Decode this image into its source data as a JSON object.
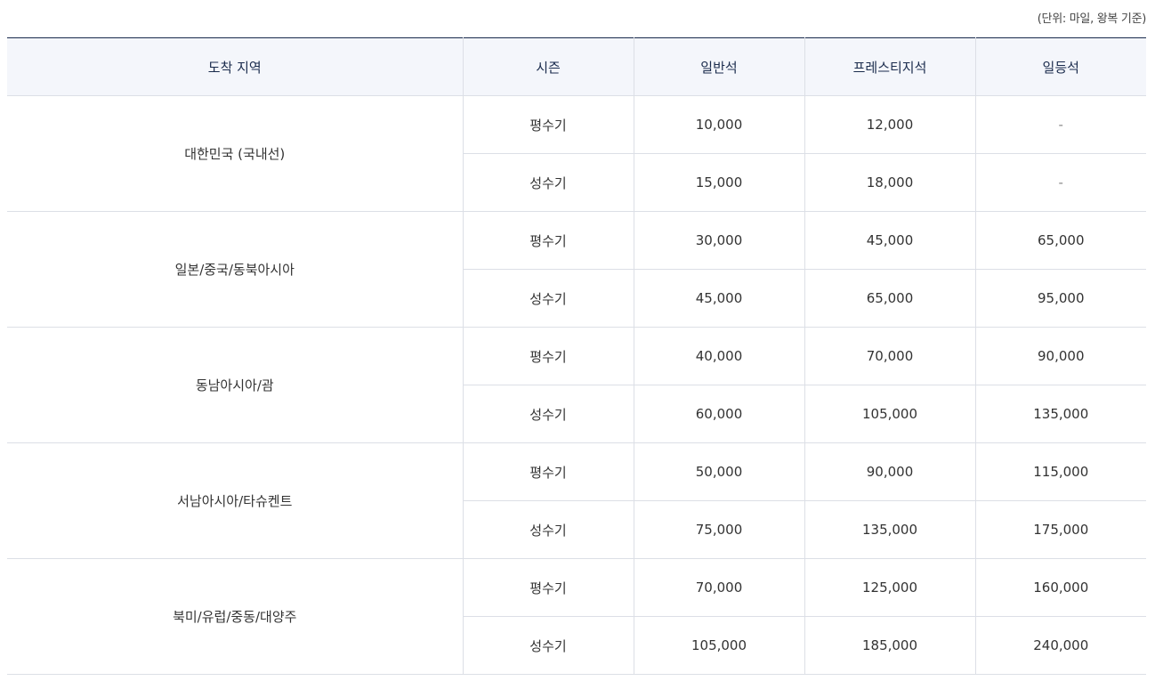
{
  "unit_note": "(단위: 마일, 왕복 기준)",
  "headers": {
    "region": "도착 지역",
    "season": "시즌",
    "standard": "일반석",
    "prestige": "프레스티지석",
    "first": "일등석"
  },
  "groups": [
    {
      "region": "대한민국 (국내선)",
      "rows": [
        {
          "season": "평수기",
          "standard": "10,000",
          "prestige": "12,000",
          "first": "-"
        },
        {
          "season": "성수기",
          "standard": "15,000",
          "prestige": "18,000",
          "first": "-"
        }
      ]
    },
    {
      "region": "일본/중국/동북아시아",
      "rows": [
        {
          "season": "평수기",
          "standard": "30,000",
          "prestige": "45,000",
          "first": "65,000"
        },
        {
          "season": "성수기",
          "standard": "45,000",
          "prestige": "65,000",
          "first": "95,000"
        }
      ]
    },
    {
      "region": "동남아시아/괌",
      "rows": [
        {
          "season": "평수기",
          "standard": "40,000",
          "prestige": "70,000",
          "first": "90,000"
        },
        {
          "season": "성수기",
          "standard": "60,000",
          "prestige": "105,000",
          "first": "135,000"
        }
      ]
    },
    {
      "region": "서남아시아/타슈켄트",
      "rows": [
        {
          "season": "평수기",
          "standard": "50,000",
          "prestige": "90,000",
          "first": "115,000"
        },
        {
          "season": "성수기",
          "standard": "75,000",
          "prestige": "135,000",
          "first": "175,000"
        }
      ]
    },
    {
      "region": "북미/유럽/중동/대양주",
      "rows": [
        {
          "season": "평수기",
          "standard": "70,000",
          "prestige": "125,000",
          "first": "160,000"
        },
        {
          "season": "성수기",
          "standard": "105,000",
          "prestige": "185,000",
          "first": "240,000"
        }
      ]
    }
  ]
}
